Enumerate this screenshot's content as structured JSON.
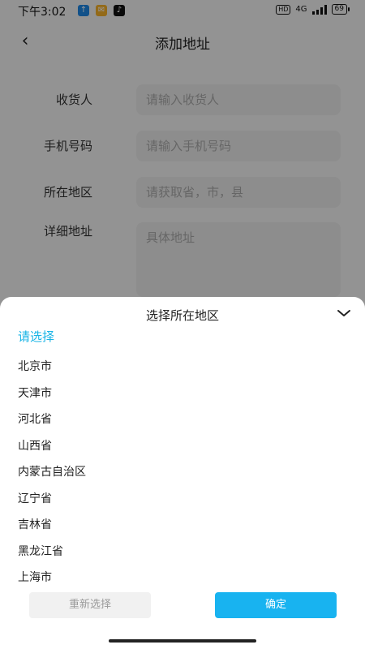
{
  "statusbar": {
    "time": "下午3:02",
    "network": "4G",
    "battery": "69"
  },
  "navbar": {
    "back_icon": "chevron-left-icon",
    "title": "添加地址"
  },
  "form": {
    "receiver": {
      "label": "收货人",
      "placeholder": "请输入收货人"
    },
    "phone": {
      "label": "手机号码",
      "placeholder": "请输入手机号码"
    },
    "region": {
      "label": "所在地区",
      "placeholder": "请获取省，市，县"
    },
    "detail": {
      "label": "详细地址",
      "placeholder": "具体地址"
    }
  },
  "sheet": {
    "title": "选择所在地区",
    "current": "请选择",
    "items": [
      {
        "label": "北京市"
      },
      {
        "label": "天津市"
      },
      {
        "label": "河北省"
      },
      {
        "label": "山西省"
      },
      {
        "label": "内蒙古自治区"
      },
      {
        "label": "辽宁省"
      },
      {
        "label": "吉林省"
      },
      {
        "label": "黑龙江省"
      },
      {
        "label": "上海市"
      }
    ],
    "reset_label": "重新选择",
    "confirm_label": "确定"
  },
  "colors": {
    "accent": "#18b3f0",
    "current_text": "#19b4e6",
    "overlay": "rgba(0,0,0,0.40)"
  }
}
